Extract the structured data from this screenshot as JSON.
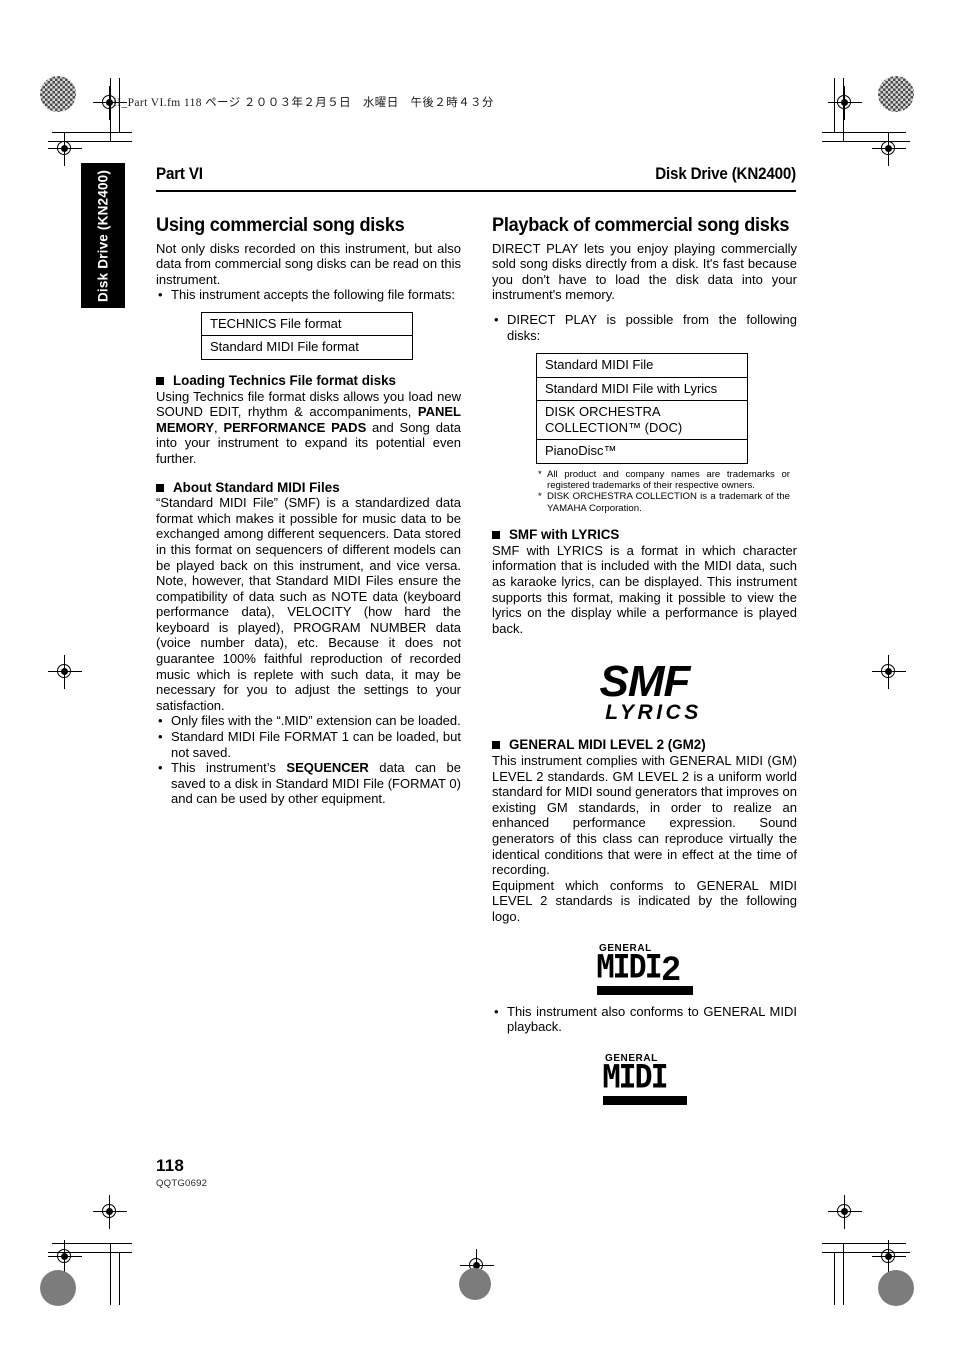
{
  "document": {
    "file_header": "II_Part VI.fm  118 ページ  ２００３年２月５日　水曜日　午後２時４３分",
    "running_head_left": "Part VI",
    "running_head_right": "Disk Drive (KN2400)",
    "side_tab": "Disk Drive (KN2400)",
    "page_number": "118",
    "part_number": "QQTG0692"
  },
  "left_column": {
    "section_title": "Using commercial song disks",
    "intro": "Not only disks recorded on this instrument, but also data from commercial song disks can be read on this instrument.",
    "bullet_formats": "This instrument accepts the following file formats:",
    "format_table": [
      "TECHNICS File format",
      "Standard MIDI File format"
    ],
    "loading": {
      "heading": "Loading Technics File format disks",
      "text_part1": "Using Technics file format disks allows you load new SOUND EDIT, rhythm & accompaniments, ",
      "bold1": "PANEL MEMORY",
      "text_mid": ", ",
      "bold2": "PERFORMANCE PADS",
      "text_part2": " and Song data into your instrument to expand its potential even further."
    },
    "about_smf": {
      "heading": "About Standard MIDI Files",
      "text": "“Standard MIDI File” (SMF) is a standardized data format which makes it possible for music data to be exchanged among different sequencers. Data stored in this format on sequencers of different models can be played back on this instrument, and vice versa. Note, however, that Standard MIDI Files ensure the compatibility of data such as NOTE data (keyboard performance data), VELOCITY (how hard the keyboard is played), PROGRAM NUMBER data (voice number data), etc. Because it does not guarantee 100% faithful reproduction of recorded music which is replete with such data, it may be necessary for you to adjust the settings to your satisfaction.",
      "bullets": [
        "Only files with the “.MID” extension can be loaded.",
        "Standard MIDI File FORMAT 1 can be loaded, but not saved."
      ],
      "bullet3_part1": "This instrument’s ",
      "bullet3_bold": "SEQUENCER",
      "bullet3_part2": " data can be saved to a disk in Standard MIDI File (FORMAT 0) and can be used by other equipment."
    }
  },
  "right_column": {
    "section_title": "Playback of commercial song disks",
    "intro": "DIRECT PLAY lets you enjoy playing commercially sold song disks directly from a disk. It's fast because you don't have to load the disk data into your instrument's memory.",
    "bullet_disks": "DIRECT PLAY is possible from the following disks:",
    "disk_table": [
      "Standard MIDI File",
      "Standard MIDI File with Lyrics",
      "DISK ORCHESTRA COLLECTION™ (DOC)",
      "PianoDisc™"
    ],
    "footnotes": [
      "All product and company names are trademarks or registered trademarks of their respective owners.",
      "DISK ORCHESTRA COLLECTION is a trademark of the YAMAHA Corporation."
    ],
    "smf_lyrics": {
      "heading": "SMF with LYRICS",
      "text": "SMF with LYRICS is a format in which character information that is included with the MIDI data, such as karaoke lyrics, can be displayed. This instrument supports this format, making it possible to view the lyrics on the display while a performance is played back.",
      "logo_top": "SMF",
      "logo_bottom": "LYRICS"
    },
    "gm2": {
      "heading": "GENERAL MIDI LEVEL 2 (GM2)",
      "text_p1": "This instrument complies with GENERAL MIDI (GM) LEVEL 2 standards. GM LEVEL 2 is a uniform world standard for MIDI sound generators that improves on existing GM standards, in order to realize an enhanced performance expression. Sound generators of this class can reproduce virtually the identical conditions that were in effect at the time of recording.",
      "text_p2": "Equipment which conforms to GENERAL MIDI LEVEL 2 standards is indicated by the following logo.",
      "logo_general": "GENERAL",
      "logo_midi": "MIDI",
      "logo_level": "2",
      "bullet": "This instrument also conforms to GENERAL MIDI playback.",
      "logo2_general": "GENERAL",
      "logo2_midi": "MIDI"
    }
  }
}
